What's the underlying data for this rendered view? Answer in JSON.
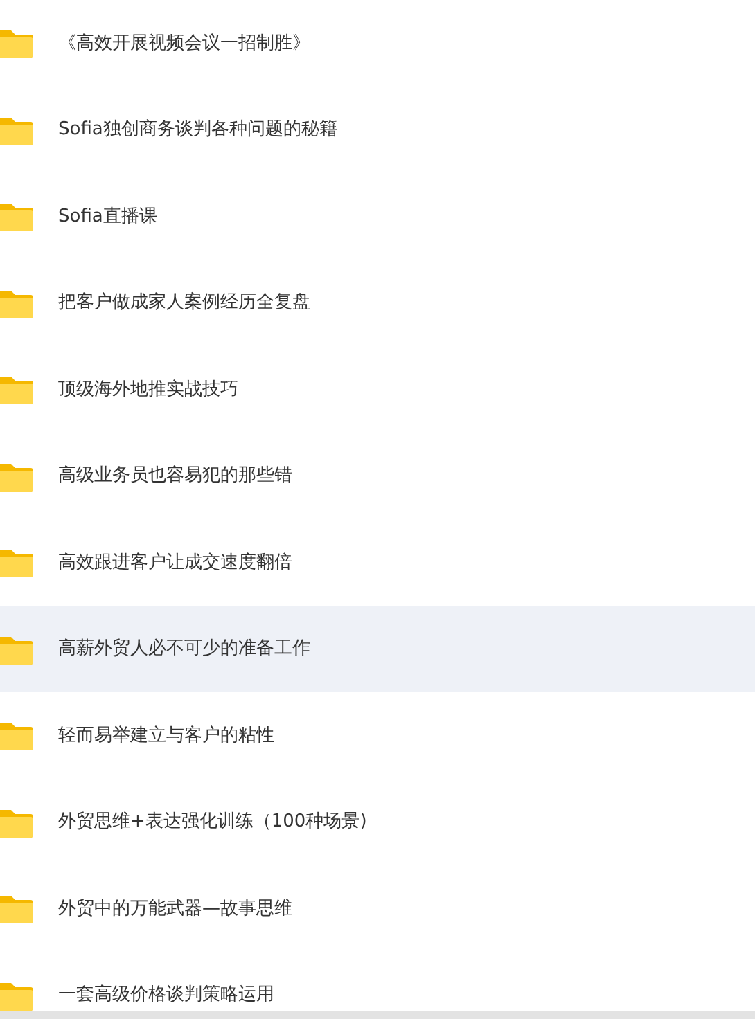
{
  "folders": [
    {
      "name": "《高效开展视频会议一招制胜》",
      "selected": false
    },
    {
      "name": "Sofia独创商务谈判各种问题的秘籍",
      "selected": false
    },
    {
      "name": "Sofia直播课",
      "selected": false
    },
    {
      "name": "把客户做成家人案例经历全复盘",
      "selected": false
    },
    {
      "name": "顶级海外地推实战技巧",
      "selected": false
    },
    {
      "name": "高级业务员也容易犯的那些错",
      "selected": false
    },
    {
      "name": "高效跟进客户让成交速度翻倍",
      "selected": false
    },
    {
      "name": "高薪外贸人必不可少的准备工作",
      "selected": true
    },
    {
      "name": "轻而易举建立与客户的粘性",
      "selected": false
    },
    {
      "name": "外贸思维+表达强化训练（100种场景)",
      "selected": false
    },
    {
      "name": "外贸中的万能武器—故事思维",
      "selected": false
    },
    {
      "name": "一套高级价格谈判策略运用",
      "selected": false
    }
  ]
}
